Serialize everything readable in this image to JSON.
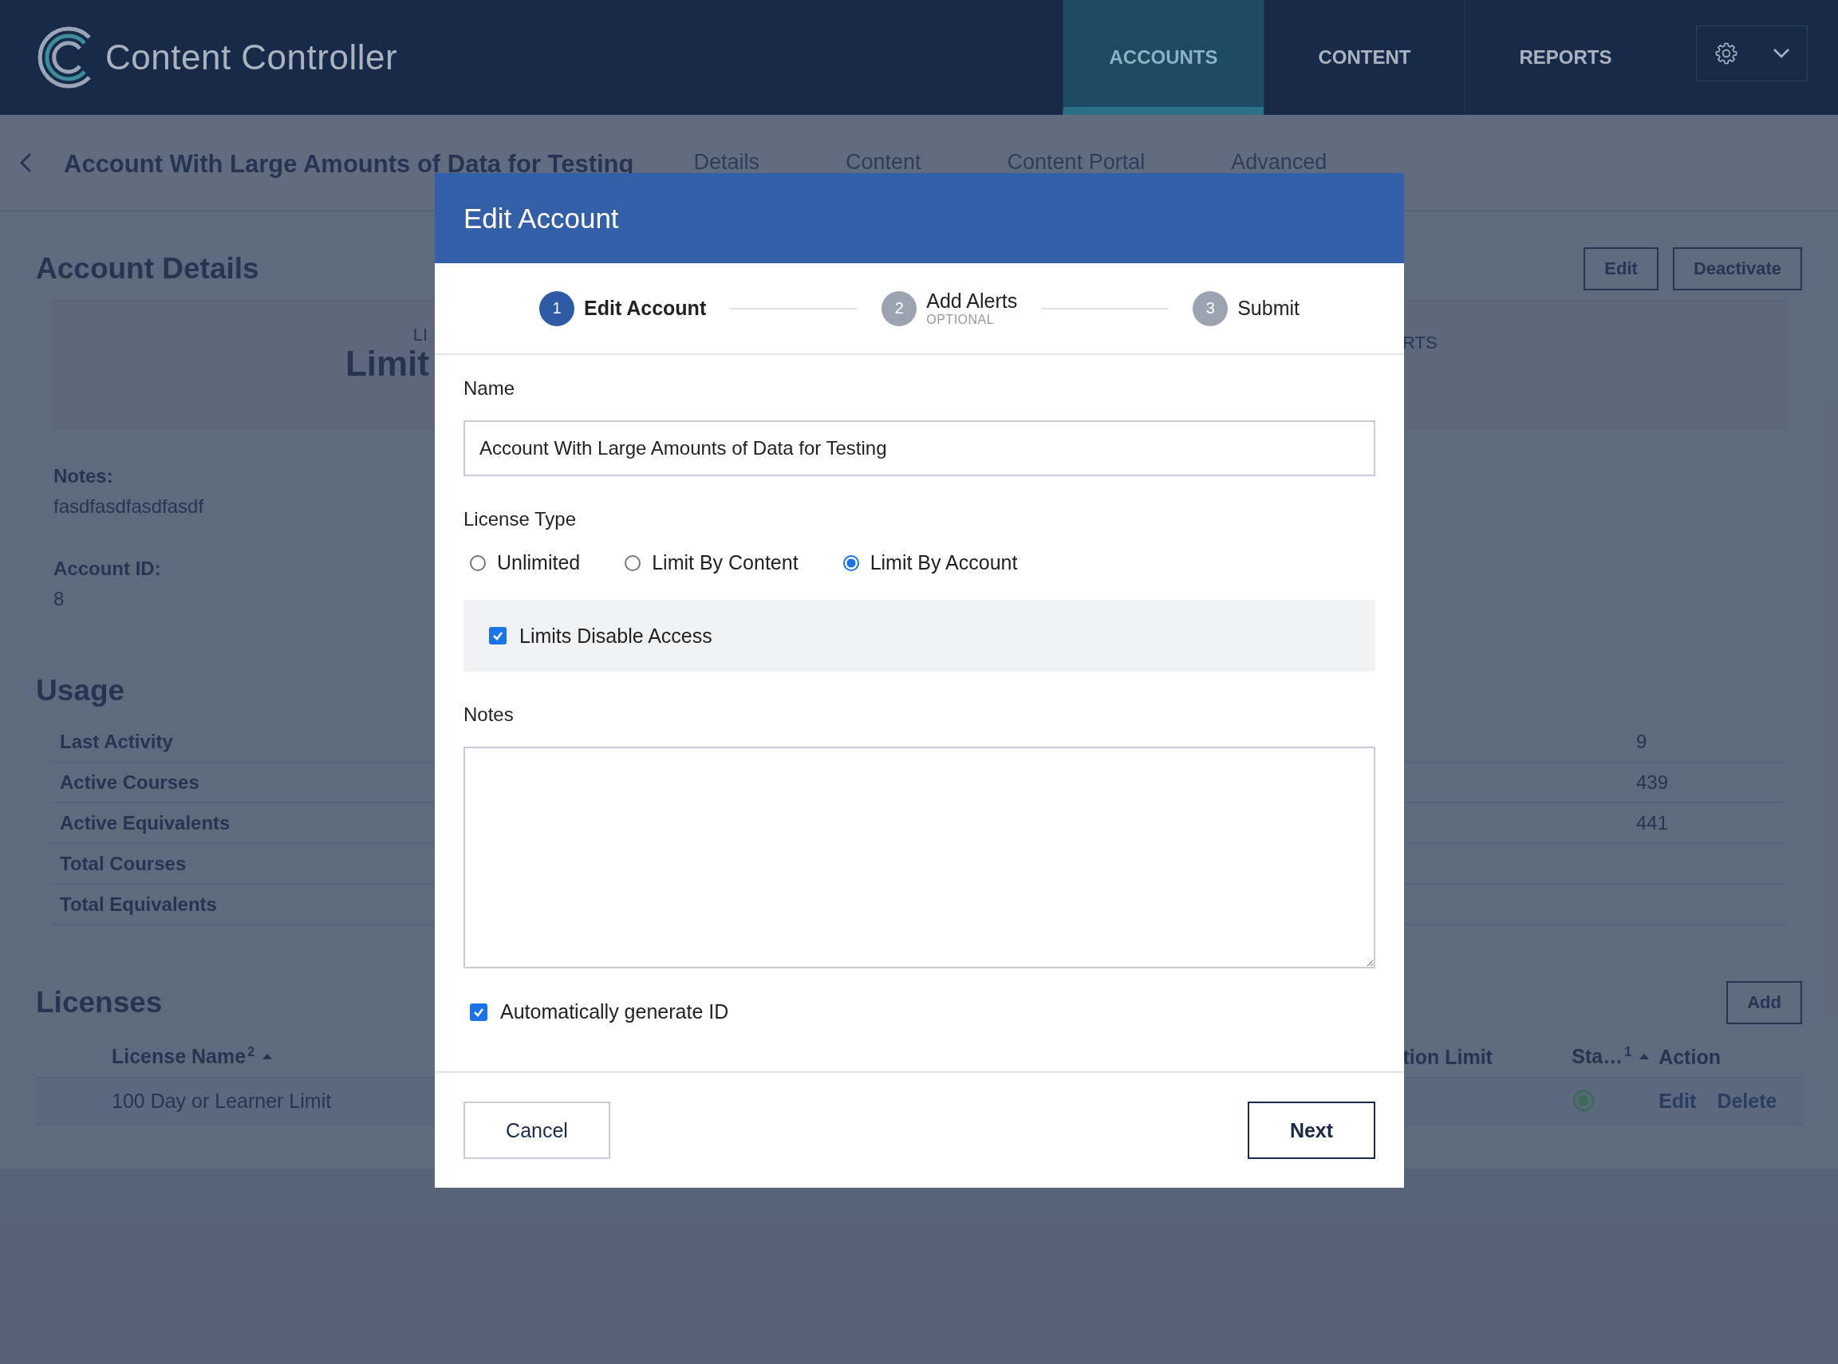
{
  "header": {
    "logo_text": "Content Controller",
    "nav": [
      {
        "label": "ACCOUNTS",
        "selected": true
      },
      {
        "label": "CONTENT",
        "selected": false
      },
      {
        "label": "REPORTS",
        "selected": false
      }
    ]
  },
  "page": {
    "title": "Account With Large Amounts of Data for Testing",
    "tabs": [
      "Details",
      "Content",
      "Content Portal",
      "Advanced"
    ]
  },
  "account_details": {
    "heading": "Account Details",
    "actions": [
      "Edit",
      "Deactivate"
    ],
    "summary": {
      "column_1_label": "LI",
      "column_1_value": "Limit",
      "column_2_label": "RTS"
    },
    "notes_label": "Notes:",
    "notes": "fasdfasdfasdfasdf",
    "account_id_label": "Account ID:",
    "account_id": "8"
  },
  "usage": {
    "heading": "Usage",
    "rows": [
      {
        "label": "Last Activity",
        "value": "9"
      },
      {
        "label": "Active Courses",
        "value": "439"
      },
      {
        "label": "Active Equivalents",
        "value": "441"
      },
      {
        "label": "Total Courses"
      },
      {
        "label": "Total Equivalents"
      }
    ]
  },
  "licenses": {
    "heading": "Licenses",
    "add_button": "Add",
    "columns": [
      {
        "label": "License Name",
        "sort_order": "2",
        "sorted": true
      },
      {
        "label": "tion Limit",
        "sorted": false
      },
      {
        "label": "Sta…",
        "sort_order": "1",
        "sorted": true
      },
      {
        "label": "Action",
        "sorted": false
      }
    ],
    "rows": [
      {
        "license_name": "100 Day or Learner Limit",
        "color": "#3d6b5a",
        "actions": [
          "Edit",
          "Delete"
        ]
      }
    ]
  },
  "modal": {
    "title": "Edit Account",
    "steps": [
      {
        "number": "1",
        "label": "Edit Account",
        "selected": true
      },
      {
        "number": "2",
        "label": "Add Alerts",
        "sublabel": "OPTIONAL",
        "selected": false
      },
      {
        "number": "3",
        "label": "Submit",
        "selected": false
      }
    ],
    "name_label": "Name",
    "name_value": "Account With Large Amounts of Data for Testing",
    "license_type_label": "License Type",
    "license_types": [
      {
        "label": "Unlimited",
        "selected": false
      },
      {
        "label": "Limit By Content",
        "selected": false
      },
      {
        "label": "Limit By Account",
        "selected": true
      }
    ],
    "limits_disable_access": {
      "label": "Limits Disable Access",
      "checked": true
    },
    "notes_label": "Notes",
    "auto_id": {
      "label": "Automatically generate ID",
      "checked": true
    },
    "cancel": "Cancel",
    "next": "Next"
  }
}
